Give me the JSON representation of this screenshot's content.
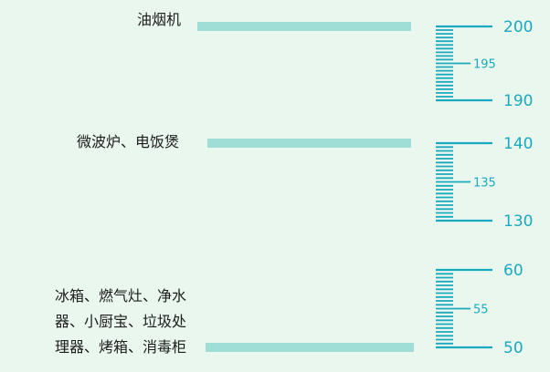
{
  "chart_data": {
    "type": "bar",
    "title": "",
    "xlabel": "",
    "ylabel": "",
    "axis": "broken vertical scale on the right, three segments: 50–60, 130–140, 190–200",
    "categories": [
      "油烟机",
      "微波炉、电饭煲",
      "冰箱、燃气灶、净水器、小厨宝、垃圾处理器、烤箱、消毒柜"
    ],
    "category_lines": [
      [
        "油烟机"
      ],
      [
        "微波炉、电饭煲"
      ],
      [
        "冰箱、燃气灶、净水",
        "器、小厨宝、垃圾处",
        "理器、烤箱、消毒柜"
      ]
    ],
    "values": [
      200,
      140,
      50
    ],
    "value_unit": "",
    "segments": [
      {
        "min": 190,
        "max": 200,
        "major": [
          190,
          200
        ],
        "mid": 195
      },
      {
        "min": 130,
        "max": 140,
        "major": [
          130,
          140
        ],
        "mid": 135
      },
      {
        "min": 50,
        "max": 60,
        "major": [
          50,
          60
        ],
        "mid": 55
      }
    ],
    "grid": false,
    "colors": {
      "background": "#e9f7ef",
      "bar": "#9fded6",
      "axis": "#1aa9be",
      "label": "#1d1d1d"
    }
  }
}
